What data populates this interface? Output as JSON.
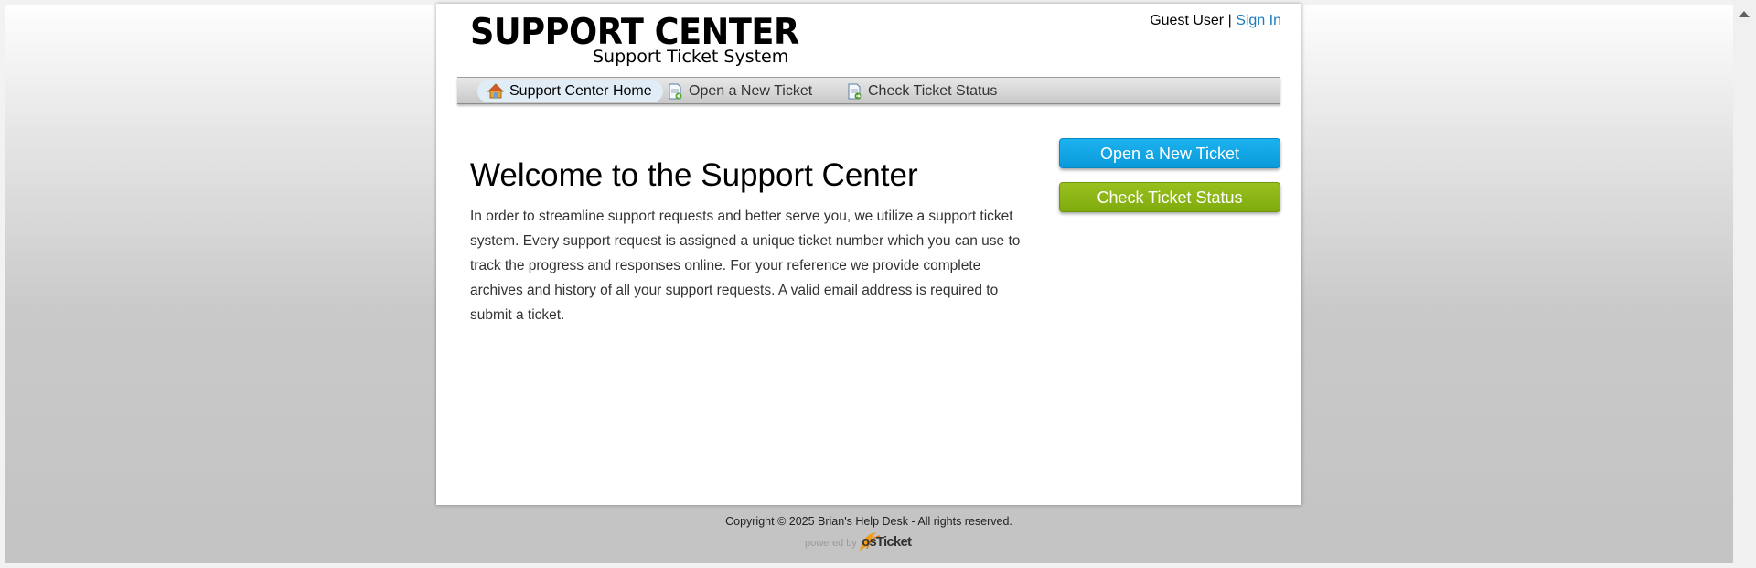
{
  "header": {
    "logo_title": "SUPPORT CENTER",
    "logo_subtitle": "Support Ticket System",
    "user_label": "Guest User",
    "separator": "|",
    "sign_in": "Sign In"
  },
  "nav": {
    "items": [
      {
        "label": "Support Center Home",
        "icon": "home-icon",
        "active": true
      },
      {
        "label": "Open a New Ticket",
        "icon": "new-ticket-icon",
        "active": false
      },
      {
        "label": "Check Ticket Status",
        "icon": "ticket-status-icon",
        "active": false
      }
    ]
  },
  "main": {
    "title": "Welcome to the Support Center",
    "intro": "In order to streamline support requests and better serve you, we utilize a support ticket system. Every support request is assigned a unique ticket number which you can use to track the progress and responses online. For your reference we provide complete archives and history of all your support requests. A valid email address is required to submit a ticket."
  },
  "sidebar": {
    "open_ticket_button": "Open a New Ticket",
    "check_status_button": "Check Ticket Status"
  },
  "footer": {
    "copyright": "Copyright © 2025 Brian's Help Desk - All rights reserved.",
    "powered_by": "powered by",
    "brand": "osTicket"
  },
  "colors": {
    "link": "#1a7bbf",
    "open_button": "#0fa6e6",
    "status_button": "#8cb816"
  }
}
